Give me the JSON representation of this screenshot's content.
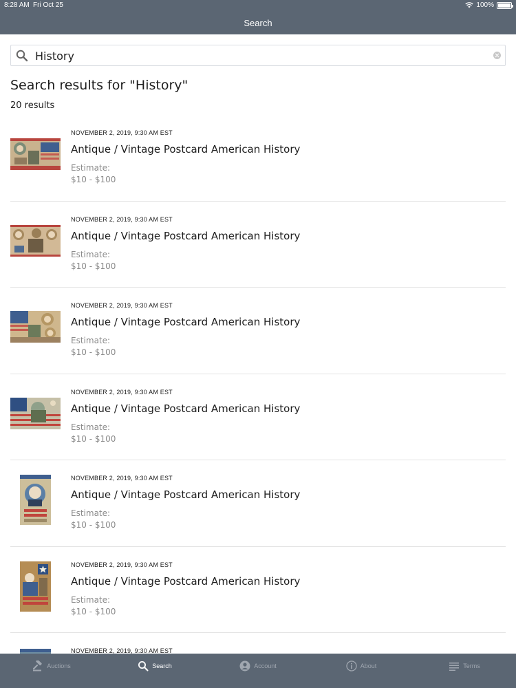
{
  "status_bar": {
    "time": "8:28 AM",
    "date": "Fri Oct 25",
    "battery": "100%"
  },
  "nav": {
    "title": "Search"
  },
  "search": {
    "value": "History",
    "placeholder": ""
  },
  "results": {
    "heading": "Search results for \"History\"",
    "count": "20 results",
    "items": [
      {
        "date": "NOVEMBER 2, 2019, 9:30 AM EST",
        "title": "Antique / Vintage Postcard  American History",
        "estimate_label": "Estimate:",
        "estimate_value": "$10 - $100"
      },
      {
        "date": "NOVEMBER 2, 2019, 9:30 AM EST",
        "title": "Antique / Vintage Postcard  American History",
        "estimate_label": "Estimate:",
        "estimate_value": "$10 - $100"
      },
      {
        "date": "NOVEMBER 2, 2019, 9:30 AM EST",
        "title": "Antique / Vintage Postcard  American History",
        "estimate_label": "Estimate:",
        "estimate_value": "$10 - $100"
      },
      {
        "date": "NOVEMBER 2, 2019, 9:30 AM EST",
        "title": "Antique / Vintage Postcard  American History",
        "estimate_label": "Estimate:",
        "estimate_value": "$10 - $100"
      },
      {
        "date": "NOVEMBER 2, 2019, 9:30 AM EST",
        "title": "Antique / Vintage Postcard  American History",
        "estimate_label": "Estimate:",
        "estimate_value": "$10 - $100"
      },
      {
        "date": "NOVEMBER 2, 2019, 9:30 AM EST",
        "title": "Antique / Vintage Postcard  American History",
        "estimate_label": "Estimate:",
        "estimate_value": "$10 - $100"
      },
      {
        "date": "NOVEMBER 2, 2019, 9:30 AM EST",
        "title": "",
        "estimate_label": "",
        "estimate_value": ""
      }
    ]
  },
  "tabs": [
    {
      "label": "Auctions",
      "icon": "gavel-icon",
      "active": false
    },
    {
      "label": "Search",
      "icon": "search-icon",
      "active": true
    },
    {
      "label": "Account",
      "icon": "account-icon",
      "active": false
    },
    {
      "label": "About",
      "icon": "info-icon",
      "active": false
    },
    {
      "label": "Terms",
      "icon": "list-icon",
      "active": false
    }
  ],
  "colors": {
    "header": "#5b6673",
    "tab_inactive": "#a0a7b0",
    "tab_active": "#ffffff",
    "muted_text": "#8a8a8a"
  }
}
